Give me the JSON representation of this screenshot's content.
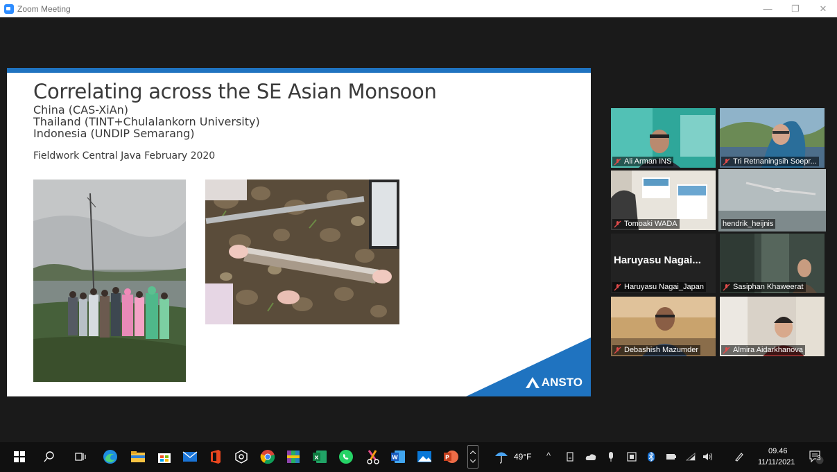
{
  "window": {
    "title": "Zoom Meeting",
    "minimize": "—",
    "maximize": "❐",
    "close": "✕"
  },
  "slide": {
    "title": "Correlating across the SE Asian Monsoon",
    "lines": [
      "China (CAS-XiAn)",
      "Thailand (TINT+Chulalankorn University)",
      "Indonesia (UNDIP Semarang)"
    ],
    "subtitle": "Fieldwork Central Java February 2020",
    "logo_text": "ANSTO",
    "accent_color": "#1f73c0"
  },
  "participants": [
    {
      "name": "Ali Arman INS",
      "muted": true
    },
    {
      "name": "Tri Retnaningsih Soepr...",
      "muted": true
    },
    {
      "name": "Tomoaki WADA",
      "muted": true
    },
    {
      "name": "hendrik_heijnis",
      "muted": false,
      "active": true
    },
    {
      "name": "Haruyasu Nagai_Japan",
      "display_name": "Haruyasu  Nagai...",
      "muted": true
    },
    {
      "name": "Sasiphan Khaweerat",
      "muted": true
    },
    {
      "name": "Debashish Mazumder",
      "muted": true
    },
    {
      "name": "Almira Aidarkhanova",
      "muted": true
    }
  ],
  "taskbar": {
    "weather": "49°F",
    "time": "09.46",
    "date": "11/11/2021",
    "notification_count": "3",
    "apps": [
      "windows-start",
      "search",
      "task-view",
      "edge",
      "file-explorer",
      "store",
      "mail",
      "office",
      "settings",
      "chrome",
      "winrar",
      "excel",
      "whatsapp",
      "snipping",
      "word",
      "photos",
      "powerpoint"
    ]
  }
}
